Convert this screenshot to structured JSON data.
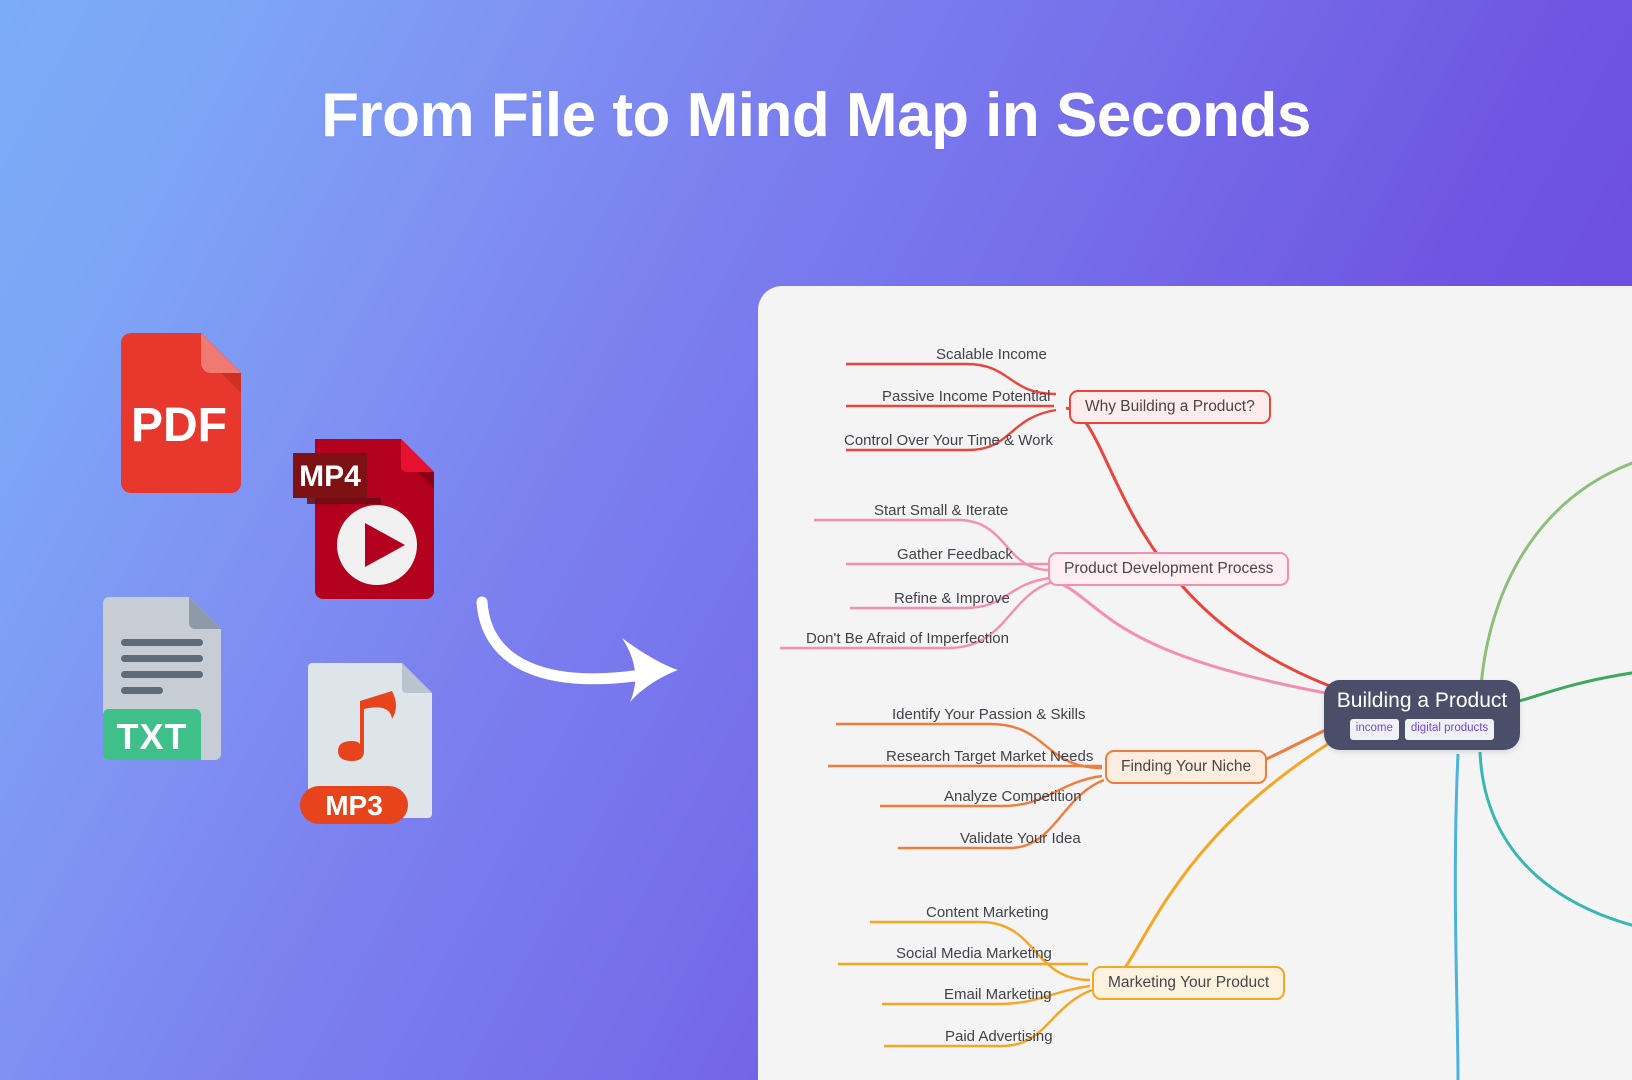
{
  "hero": {
    "title": "From File to Mind Map in Seconds"
  },
  "background": {
    "gradient_from": "#7bacf7",
    "gradient_to": "#6a46dc"
  },
  "file_icons": [
    {
      "name": "pdf",
      "label": "PDF",
      "color": "#e8382d",
      "fold_color": "#ef7a72",
      "shadow_color": "#c92e24"
    },
    {
      "name": "mp4",
      "label": "MP4",
      "color": "#b3001e",
      "badge_color": "#7d1113",
      "accent": "#ffffff"
    },
    {
      "name": "txt",
      "label": "TXT",
      "color": "#c6cdd4",
      "badge_color": "#3fbf89",
      "line_color": "#5f6b7a"
    },
    {
      "name": "mp3",
      "label": "MP3",
      "color": "#dde4ea",
      "badge_color": "#e8441c",
      "note_color": "#e8441c"
    }
  ],
  "arrow": {
    "name": "curved-arrow",
    "color": "#ffffff"
  },
  "mindmap": {
    "panel_background": "#f4f4f5",
    "center": {
      "title": "Building a Product",
      "tags": [
        "income",
        "digital products"
      ],
      "background": "#4b4e69",
      "tag_text_color": "#6a4ae0"
    },
    "branches": [
      {
        "topic": "Why Building a Product?",
        "color": "#e8453c",
        "fill": "#fdeceb",
        "children": [
          "Scalable Income",
          "Passive Income Potential",
          "Control Over Your Time & Work"
        ]
      },
      {
        "topic": "Product Development Process",
        "color": "#f58fae",
        "fill": "#fdeef2",
        "children": [
          "Start Small & Iterate",
          "Gather Feedback",
          "Refine & Improve",
          "Don't Be Afraid of Imperfection"
        ]
      },
      {
        "topic": "Finding Your Niche",
        "color": "#ef7c3a",
        "fill": "#fdeddf",
        "children": [
          "Identify Your Passion & Skills",
          "Research Target Market Needs",
          "Analyze Competition",
          "Validate Your Idea"
        ]
      },
      {
        "topic": "Marketing Your Product",
        "color": "#f5a623",
        "fill": "#fdf2de",
        "children": [
          "Content Marketing",
          "Social Media Marketing",
          "Email Marketing",
          "Paid Advertising"
        ]
      }
    ],
    "offscreen_branch_colors": [
      "#8cc07a",
      "#3fa85f",
      "#3ab7b0",
      "#4bb3dd"
    ]
  }
}
